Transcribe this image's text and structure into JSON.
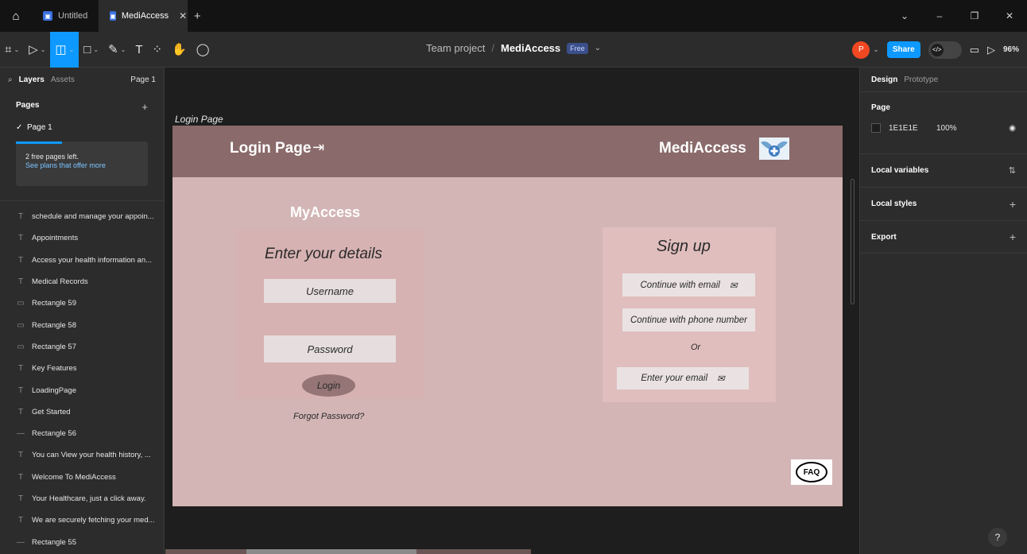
{
  "titlebar": {
    "tabs": [
      {
        "label": "Untitled",
        "active": false
      },
      {
        "label": "MediAccess",
        "active": true
      }
    ],
    "add_tab": "+",
    "controls": [
      "⌄",
      "–",
      "❐",
      "✕"
    ]
  },
  "toolbar": {
    "team": "Team project",
    "separator": "/",
    "file_name": "MediAccess",
    "plan_badge": "Free",
    "share_label": "Share",
    "avatar_initial": "P",
    "zoom": "96%"
  },
  "left_panel": {
    "tab_layers": "Layers",
    "tab_assets": "Assets",
    "page_selector": "Page 1",
    "pages_header": "Pages",
    "current_page": "Page 1",
    "notice_line1": "2 free pages left.",
    "notice_line2": "See plans that offer more",
    "layers": [
      {
        "type": "text",
        "label": "schedule and manage your appoin..."
      },
      {
        "type": "text",
        "label": "Appointments"
      },
      {
        "type": "text",
        "label": "Access your health information an..."
      },
      {
        "type": "text",
        "label": "Medical Records"
      },
      {
        "type": "rect",
        "label": "Rectangle 59"
      },
      {
        "type": "rect",
        "label": "Rectangle 58"
      },
      {
        "type": "rect",
        "label": "Rectangle 57"
      },
      {
        "type": "text",
        "label": "Key Features"
      },
      {
        "type": "text",
        "label": "LoadingPage"
      },
      {
        "type": "text",
        "label": "Get Started"
      },
      {
        "type": "line",
        "label": "Rectangle 56"
      },
      {
        "type": "text",
        "label": "You can View your health history, ..."
      },
      {
        "type": "text",
        "label": "Welcome To MediAccess"
      },
      {
        "type": "text",
        "label": "Your Healthcare, just a click away."
      },
      {
        "type": "text",
        "label": "We are securely fetching your med..."
      },
      {
        "type": "line",
        "label": "Rectangle 55"
      }
    ]
  },
  "canvas": {
    "frame_label": "Login Page",
    "header_title": "Login Page",
    "brand": "MediAccess",
    "myaccess": "MyAccess",
    "enter_details": "Enter your details",
    "username_placeholder": "Username",
    "password_placeholder": "Password",
    "login_label": "Login",
    "forgot": "Forgot Password?",
    "signup_title": "Sign up",
    "continue_email": "Continue with email",
    "continue_phone": "Continue with phone number",
    "or": "Or",
    "enter_email": "Enter your email",
    "faq": "FAQ"
  },
  "right_panel": {
    "tab_design": "Design",
    "tab_prototype": "Prototype",
    "page_header": "Page",
    "bg_hex": "1E1E1E",
    "bg_opacity": "100%",
    "local_variables": "Local variables",
    "local_styles": "Local styles",
    "export": "Export"
  },
  "colors": {
    "accent": "#0d99ff",
    "frame_header": "#8a6a6a",
    "frame_bg": "#d3b5b5"
  }
}
